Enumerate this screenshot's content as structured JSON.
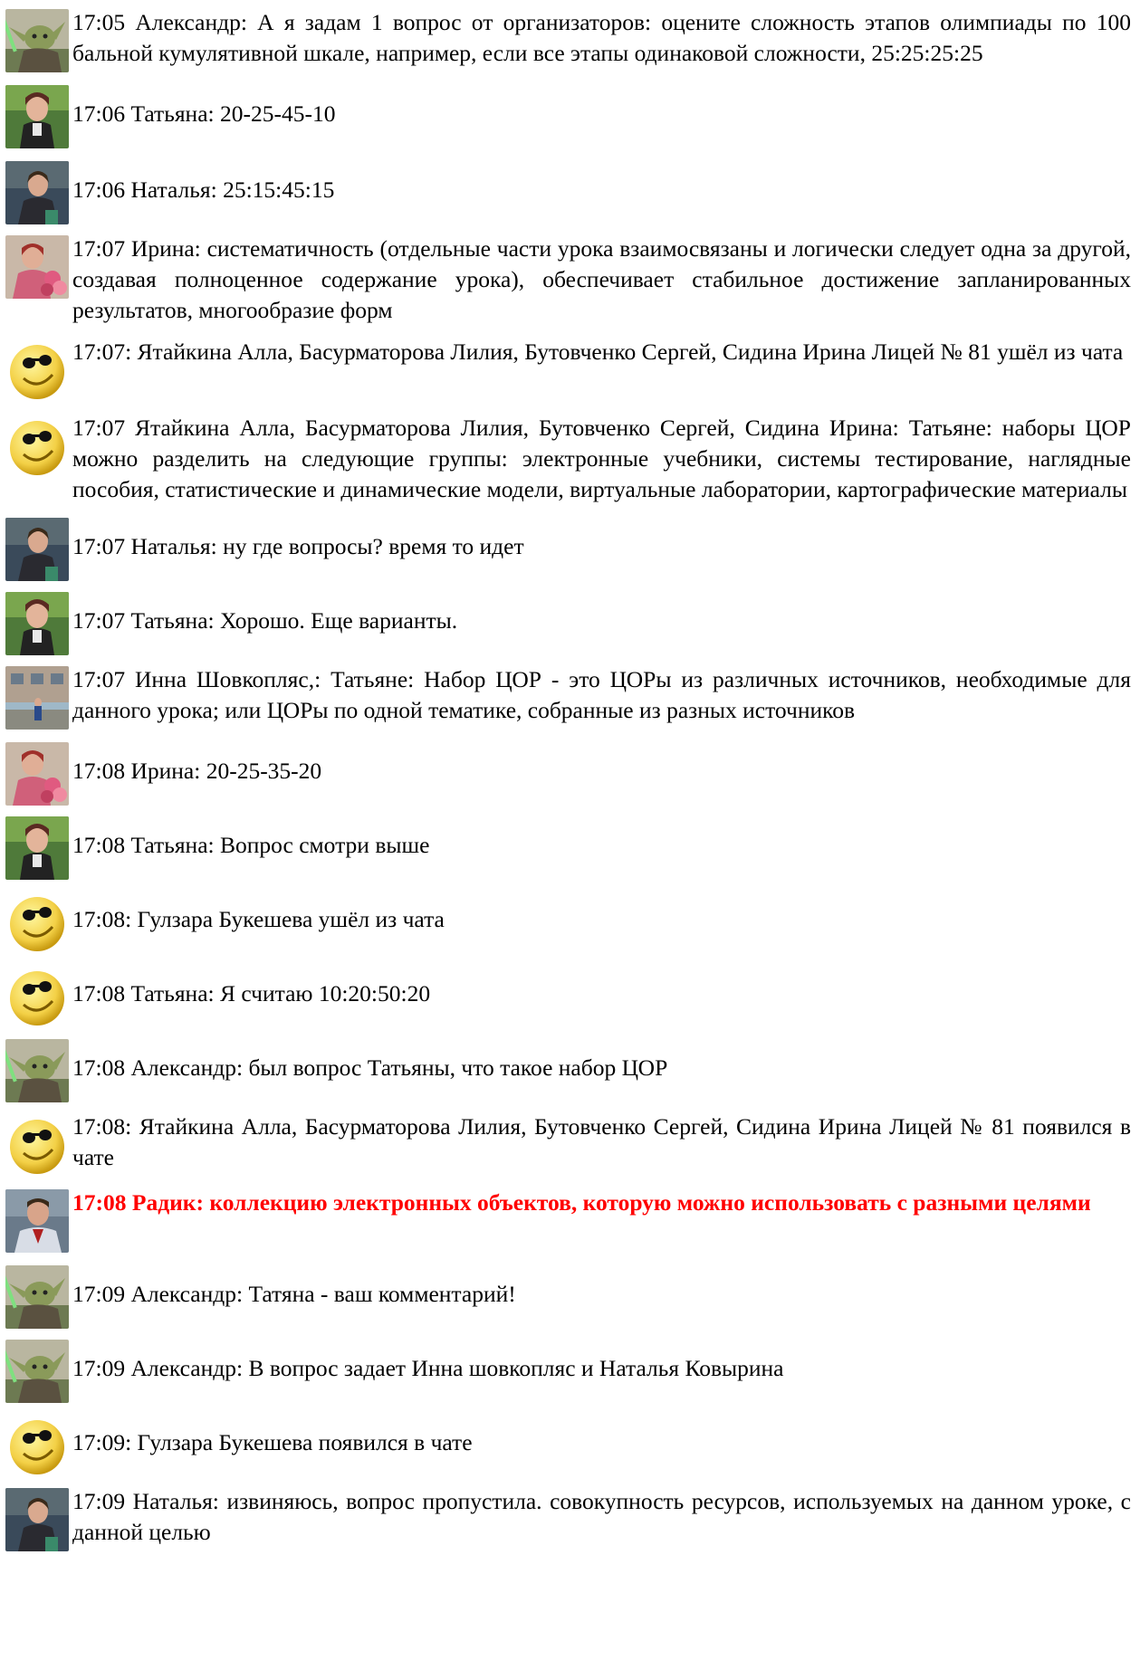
{
  "colors": {
    "text": "#000000",
    "highlight": "#ff0000",
    "background": "#ffffff"
  },
  "messages": [
    {
      "avatar": "yoda-avatar",
      "text": "17:05 Александр: А я задам 1 вопрос от организаторов: оцените сложность этапов олимпиады по 100 бальной кумулятивной шкале, например, если все этапы одинаковой сложности, 25:25:25:25"
    },
    {
      "avatar": "tatyana-avatar",
      "text": "17:06 Татьяна: 20-25-45-10"
    },
    {
      "avatar": "natalya-avatar",
      "text": "17:06 Наталья: 25:15:45:15"
    },
    {
      "avatar": "irina-avatar",
      "text": "17:07 Ирина: систематичность (отдельные части урока взаимосвязаны и логически следует одна за другой, создавая полноценное содержание урока), обеспечивает стабильное достижение запланированных результатов, многообразие форм"
    },
    {
      "avatar": "smiley-avatar",
      "text": "17:07: Ятайкина Алла, Басурматорова Лилия, Бутовченко Сергей, Сидина Ирина Лицей № 81 ушёл из чата"
    },
    {
      "avatar": "smiley-avatar",
      "text": "17:07 Ятайкина Алла, Басурматорова Лилия, Бутовченко Сергей, Сидина Ирина: Татьяне: наборы ЦОР можно разделить на следующие группы: электронные учебники, системы тестирование, наглядные пособия, статистические и динамические модели, виртуальные лаборатории, картографические материалы"
    },
    {
      "avatar": "natalya-avatar",
      "text": "17:07 Наталья: ну где вопросы? время то идет"
    },
    {
      "avatar": "tatyana-avatar",
      "text": "17:07 Татьяна: Хорошо. Еще варианты."
    },
    {
      "avatar": "inna-avatar",
      "text": "17:07 Инна Шовкопляс,: Татьяне: Набор ЦОР - это ЦОРы из различных источников, необходимые для данного урока; или ЦОРы по одной тематике, собранные из разных источников"
    },
    {
      "avatar": "irina-avatar",
      "text": "17:08 Ирина: 20-25-35-20"
    },
    {
      "avatar": "tatyana-avatar",
      "text": "17:08 Татьяна: Вопрос смотри выше"
    },
    {
      "avatar": "smiley-avatar",
      "text": "17:08: Гулзара Букешева ушёл из чата"
    },
    {
      "avatar": "smiley-avatar",
      "text": "17:08 Татьяна: Я считаю 10:20:50:20"
    },
    {
      "avatar": "yoda-avatar",
      "text": "17:08 Александр: был вопрос Татьяны, что такое набор ЦОР"
    },
    {
      "avatar": "smiley-avatar",
      "text": "17:08: Ятайкина Алла, Басурматорова Лилия, Бутовченко Сергей, Сидина Ирина Лицей № 81 появился в чате"
    },
    {
      "avatar": "radik-avatar",
      "text": "17:08 Радик: коллекцию электронных объектов, которую можно использовать с разными целями",
      "highlight": true
    },
    {
      "avatar": "yoda-avatar",
      "text": "17:09 Александр: Татяна - ваш комментарий!"
    },
    {
      "avatar": "yoda-avatar",
      "text": "17:09 Александр: В вопрос задает Инна шовкопляс и Наталья Ковырина"
    },
    {
      "avatar": "smiley-avatar",
      "text": "17:09: Гулзара Букешева появился в чате"
    },
    {
      "avatar": "natalya-avatar",
      "text": "17:09 Наталья: извиняюсь, вопрос пропустила. совокупность ресурсов, используемых на данном уроке, с данной целью"
    }
  ]
}
